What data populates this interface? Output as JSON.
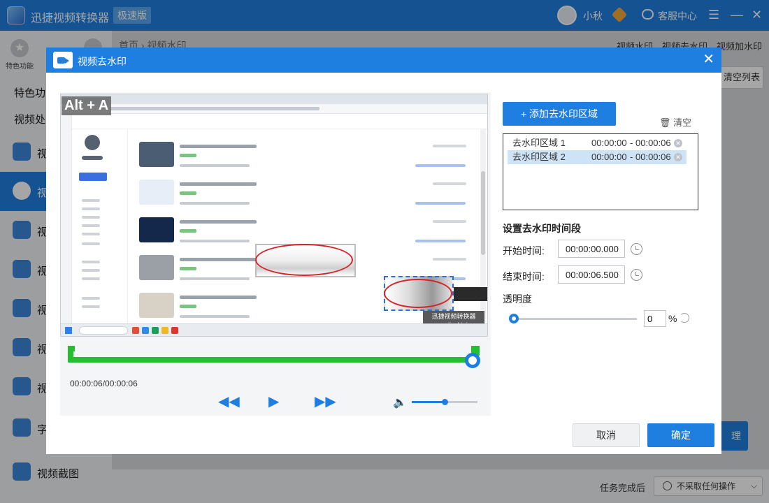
{
  "app": {
    "name": "迅捷视频转换器",
    "badge": "极速版",
    "user": "小秋",
    "service": "客服中心",
    "menu_glyph": "☰",
    "minimize_glyph": "—",
    "close_glyph": "✕"
  },
  "sidebar": {
    "feature_tab": "特色功能",
    "feature_tab_clip": "视",
    "section1": "特色功",
    "section2": "视频处",
    "items": [
      {
        "label": "视",
        "icon": "video-icon"
      },
      {
        "label": "视",
        "icon": "user-watermark-icon"
      },
      {
        "label": "视",
        "icon": "film-icon"
      },
      {
        "label": "视",
        "icon": "video-icon"
      },
      {
        "label": "视",
        "icon": "gif-icon"
      },
      {
        "label": "视",
        "icon": "video-icon"
      },
      {
        "label": "视",
        "icon": "play-icon"
      },
      {
        "label": "字",
        "icon": "star-icon"
      },
      {
        "label": "视频截图",
        "icon": "scissors-icon"
      }
    ]
  },
  "header": {
    "breadcrumb_home": "首页",
    "breadcrumb_sep": "›",
    "breadcrumb_current": "视频水印",
    "right_text": "视频水印、视频去水印、视频加水印",
    "clear_list": "清空列表"
  },
  "background": {
    "blue_btn_clip": "理",
    "after_task_label": "任务完成后",
    "after_task_value": "不采取任何操作"
  },
  "modal": {
    "title": "视频去水印",
    "close_glyph": "✕",
    "shortcut_badge": "Alt + A",
    "preview_watermark": "迅捷视频转换器 www.xunjieshipin.com",
    "timeline_time": "00:00:06/00:00:06",
    "controls": {
      "rewind_glyph": "◀◀",
      "play_glyph": "▶",
      "forward_glyph": "▶▶",
      "volume_glyph": "🔈",
      "volume_level_fraction": 0.5
    },
    "add_region_btn": "+ 添加去水印区域",
    "clear_btn": "🗑 清空",
    "regions": [
      {
        "name": "去水印区域 1",
        "start": "00:00:00",
        "end": "00:00:06",
        "selected": false
      },
      {
        "name": "去水印区域 2",
        "start": "00:00:00",
        "end": "00:00:06",
        "selected": true
      }
    ],
    "region_dash": "-",
    "region_del_glyph": "✕",
    "time_section_title": "设置去水印时间段",
    "start_label": "开始时间:",
    "start_value": "00:00:00.000",
    "end_label": "结束时间:",
    "end_value": "00:00:06.500",
    "opacity_label": "透明度",
    "opacity_value": "0",
    "opacity_unit": "%",
    "cancel": "取消",
    "confirm": "确定"
  },
  "colors": {
    "primary": "#1f7fe0",
    "timeline_green": "#22c02f",
    "ellipse_red": "#d6232a"
  }
}
